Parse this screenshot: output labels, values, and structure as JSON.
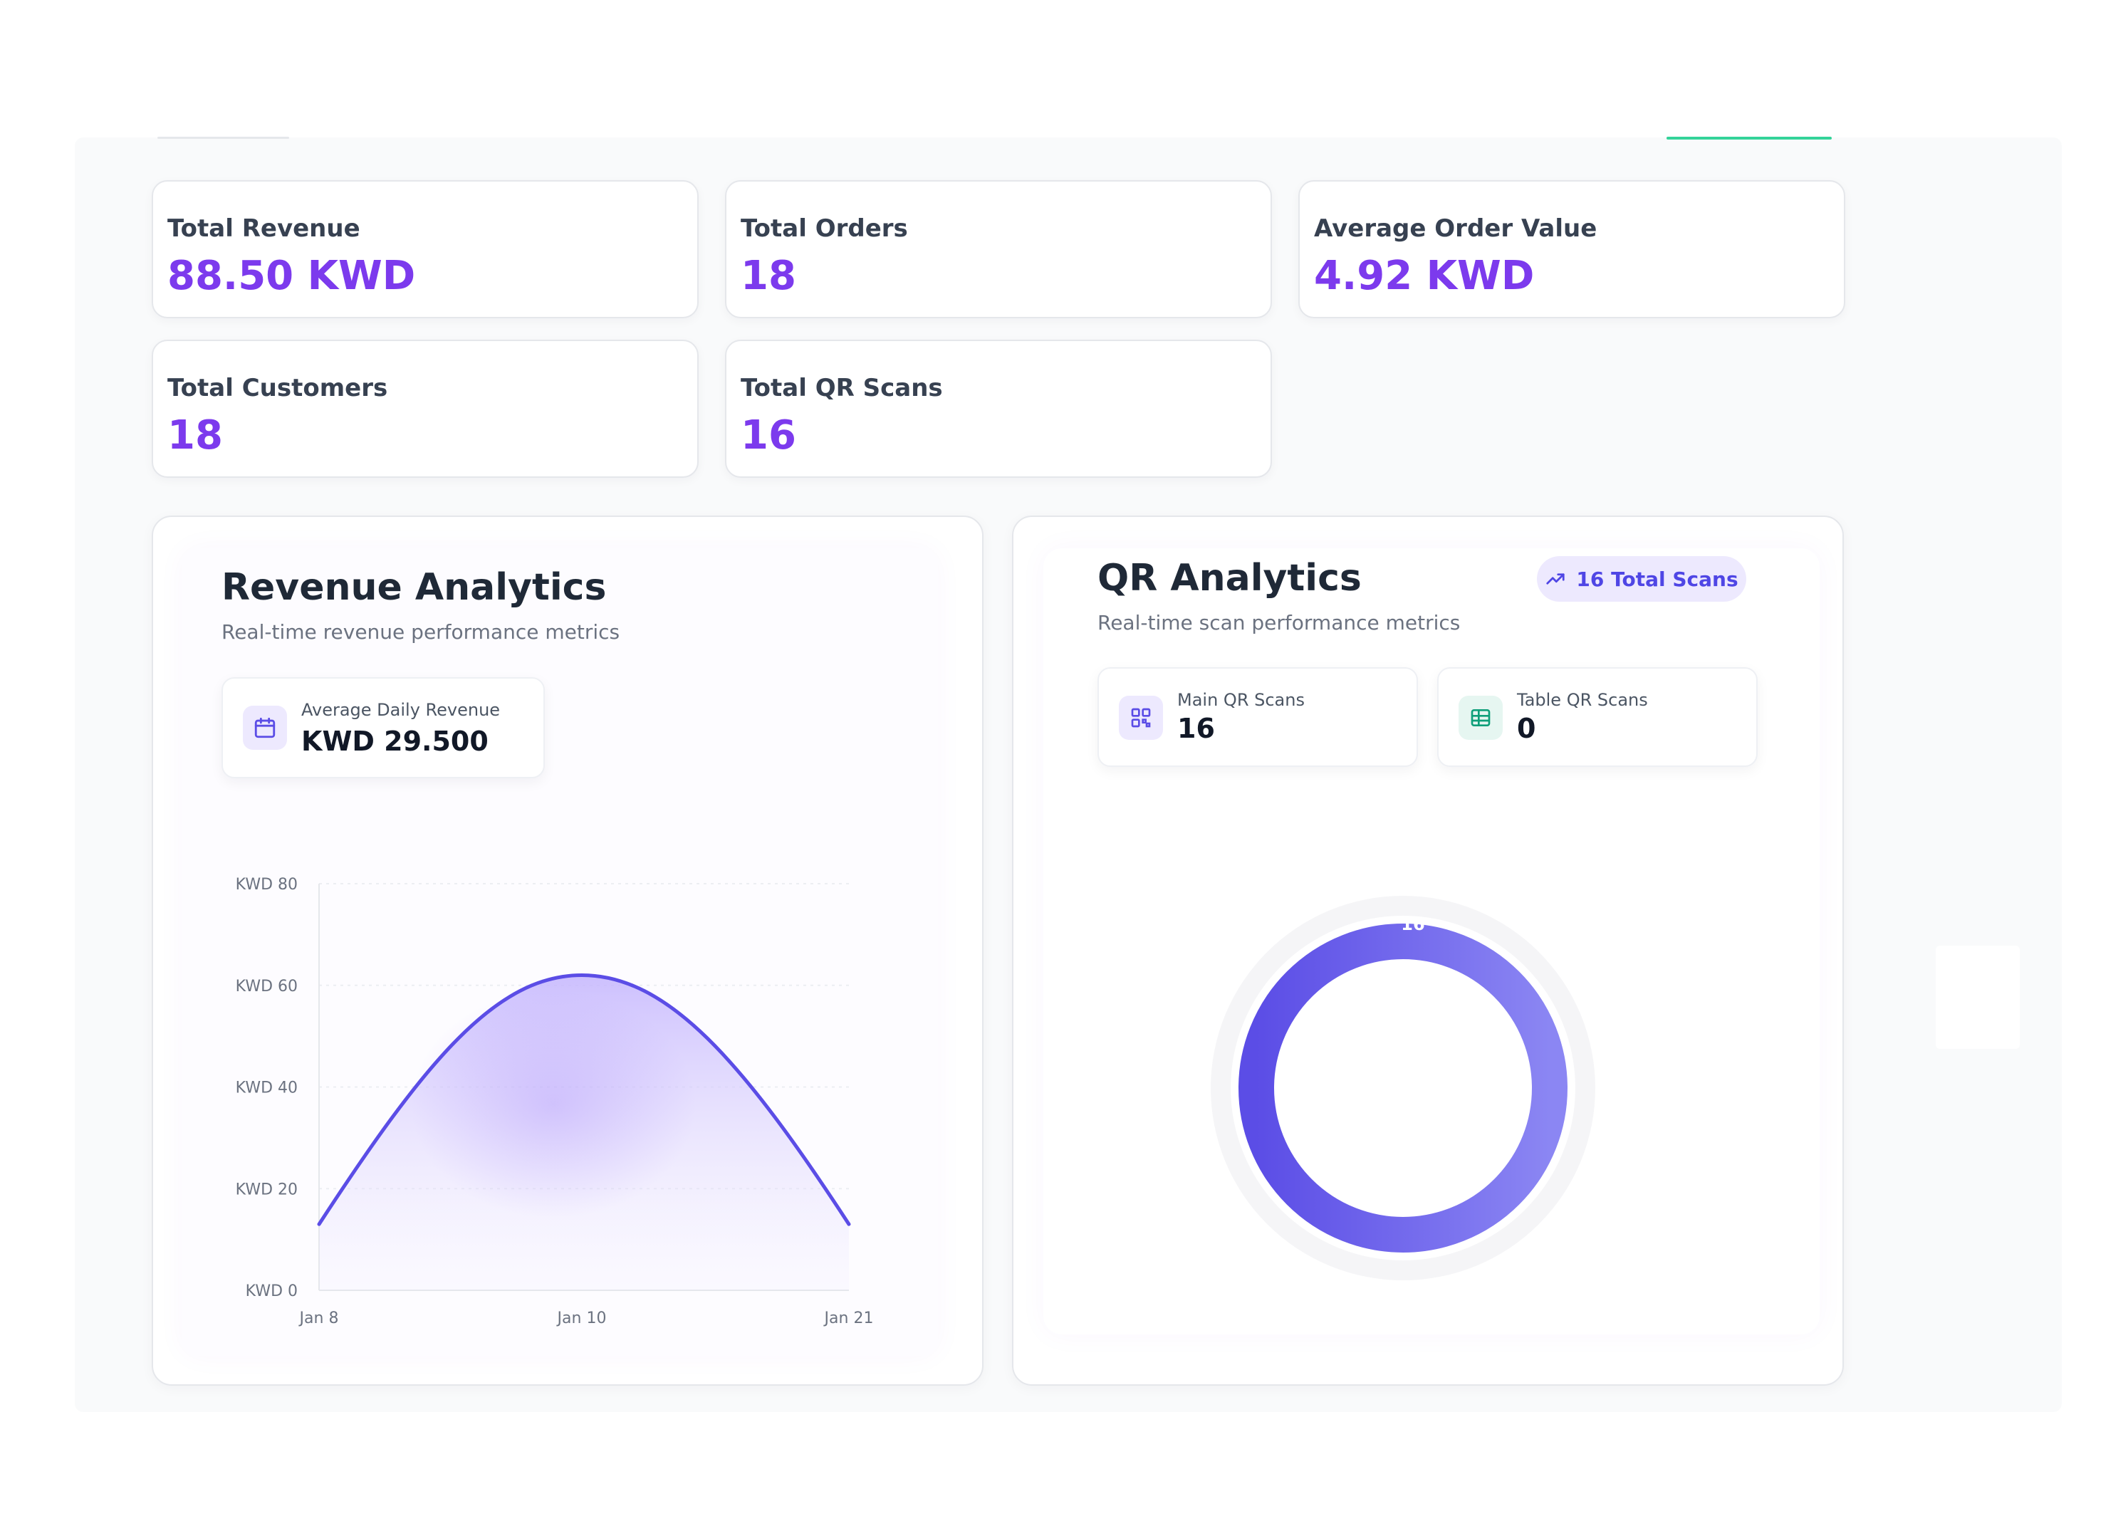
{
  "stats": [
    {
      "label": "Total Revenue",
      "value": "88.50 KWD"
    },
    {
      "label": "Total Orders",
      "value": "18"
    },
    {
      "label": "Average Order Value",
      "value": "4.92 KWD"
    },
    {
      "label": "Total Customers",
      "value": "18"
    },
    {
      "label": "Total QR Scans",
      "value": "16"
    }
  ],
  "revenue": {
    "title": "Revenue Analytics",
    "subtitle": "Real-time revenue performance metrics",
    "avg_label": "Average Daily Revenue",
    "avg_value": "KWD 29.500",
    "icon": "calendar-icon"
  },
  "qr": {
    "title": "QR Analytics",
    "subtitle": "Real-time scan performance metrics",
    "badge": "16 Total Scans",
    "badge_icon": "trending-up-icon",
    "main_label": "Main QR Scans",
    "main_value": "16",
    "main_icon": "qr-code-icon",
    "table_label": "Table QR Scans",
    "table_value": "0",
    "table_icon": "table-grid-icon"
  },
  "colors": {
    "accent": "#7c3aed",
    "line": "#5b4de6",
    "donut_top": "#5b4de6",
    "donut_bottom": "#8b86f3"
  },
  "chart_data": [
    {
      "type": "area",
      "title": "",
      "xlabel": "",
      "ylabel": "",
      "x": [
        "Jan 8",
        "Jan 10",
        "Jan 21"
      ],
      "y_tick_labels": [
        "KWD 0",
        "KWD 20",
        "KWD 40",
        "KWD 60",
        "KWD 80"
      ],
      "series": [
        {
          "values": [
            13,
            62,
            13
          ]
        }
      ],
      "ylim": [
        0,
        80
      ],
      "grid": true,
      "curve": "smooth"
    },
    {
      "type": "pie",
      "variant": "donut",
      "title": "",
      "slices": [
        {
          "label": "Main QR Scans",
          "value": 16
        },
        {
          "label": "Table QR Scans",
          "value": 0
        }
      ]
    }
  ]
}
